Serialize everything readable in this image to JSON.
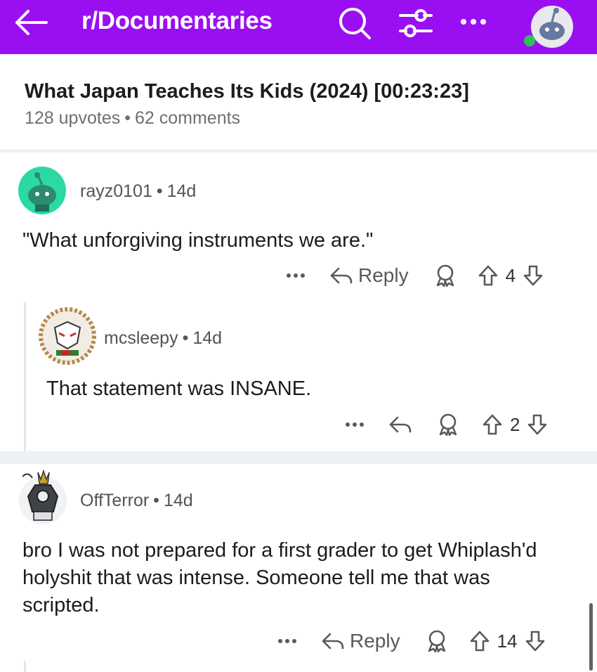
{
  "header": {
    "subreddit": "r/Documentaries",
    "bg_color": "#9a0ff2"
  },
  "post": {
    "title": "What Japan Teaches Its Kids (2024) [00:23:23]",
    "upvotes": "128 upvotes",
    "separator": "•",
    "comments": "62 comments"
  },
  "comments": [
    {
      "username": "rayz0101",
      "age": "14d",
      "text": "\"What unforgiving instruments we are.\"",
      "reply_label": "Reply",
      "votes": "4"
    },
    {
      "username": "mcsleepy",
      "age": "14d",
      "text": "That statement was INSANE.",
      "votes": "2"
    },
    {
      "username": "OffTerror",
      "age": "14d",
      "text": "bro I was not prepared for a first grader to get Whiplash'd holyshit that was intense. Someone tell me that was scripted.",
      "reply_label": "Reply",
      "votes": "14"
    }
  ],
  "icons": {
    "back": "back-arrow-icon",
    "search": "search-icon",
    "filter": "filter-icon",
    "more": "more-icon",
    "avatar": "user-avatar",
    "reply": "reply-icon",
    "award": "award-icon",
    "upvote": "upvote-icon",
    "downvote": "downvote-icon"
  }
}
